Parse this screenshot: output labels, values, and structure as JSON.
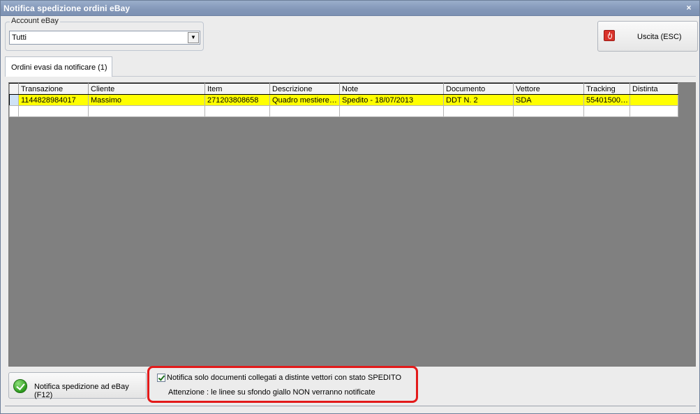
{
  "window": {
    "title": "Notifica spedizione ordini eBay",
    "close_glyph": "×"
  },
  "account": {
    "legend": "Account eBay",
    "selected": "Tutti"
  },
  "exit_button": {
    "label": "Uscita (ESC)",
    "icon": "power-icon"
  },
  "tabs": [
    {
      "label": "Ordini evasi da notificare (1)",
      "active": true
    }
  ],
  "grid": {
    "columns": [
      "Transazione",
      "Cliente",
      "Item",
      "Descrizione",
      "Note",
      "Documento",
      "Vettore",
      "Tracking",
      "Distinta"
    ],
    "rows": [
      [
        "1144828984017",
        "Massimo",
        "271203808658",
        "Quadro mestiere…",
        "Spedito - 18/07/2013",
        "DDT N. 2",
        "SDA",
        "55401500…",
        ""
      ]
    ],
    "highlight_color": "#ffff00"
  },
  "notify_button": {
    "label": "Notifica spedizione ad eBay (F12)",
    "icon": "green-check-icon"
  },
  "notice": {
    "checkbox_label": "Notifica solo documenti  collegati a distinte vettori con stato SPEDITO",
    "checked": true,
    "warning": "Attenzione : le linee su sfondo giallo NON verranno notificate",
    "border_color": "#e31a1a"
  }
}
